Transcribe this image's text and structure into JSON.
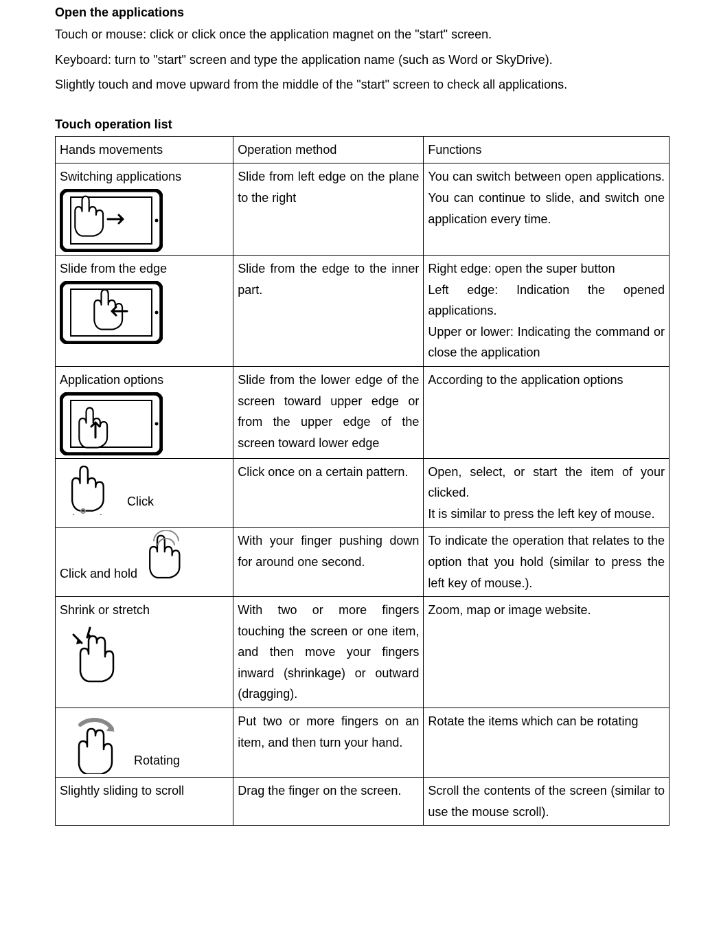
{
  "heading_open": "Open the applications",
  "open_p1": "Touch or mouse: click or click once the application magnet on the \"start\" screen.",
  "open_p2": "Keyboard: turn to \"start\" screen and type the application name (such as Word or SkyDrive).",
  "open_p3": "Slightly touch and move upward from the middle of the \"start\" screen to check all applications.",
  "heading_touch": "Touch operation list",
  "table": {
    "header": {
      "c1": "Hands movements",
      "c2": "Operation method",
      "c3": "Functions"
    },
    "rows": [
      {
        "label": "Switching applications",
        "icon": "tablet-swipe-left",
        "method": "Slide from left edge on the plane to the right",
        "func": "You can switch between open applications. You can continue to slide, and switch one application every time."
      },
      {
        "label": "Slide from the edge",
        "icon": "tablet-swipe-right-edge",
        "method": "Slide from the edge to the inner part.",
        "func": "Right edge: open the super button\nLeft edge: Indication the opened applications.\nUpper or lower: Indicating the command or close the application"
      },
      {
        "label": "Application options",
        "icon": "tablet-swipe-up",
        "method": "Slide from the lower edge of the screen toward upper edge or from the upper edge of the screen toward lower edge",
        "func": "According to the application options"
      },
      {
        "label": "Click",
        "icon": "hand-tap",
        "method": "Click once on a certain pattern.",
        "func": "Open, select, or start the item of your clicked.\nIt is similar to press the left key of mouse."
      },
      {
        "label": "Click and hold",
        "icon": "hand-tap-hold",
        "method": "With your finger pushing down for around one second.",
        "func": "To indicate the operation that relates to the option that you hold (similar to press the left key of mouse.)."
      },
      {
        "label": "Shrink or stretch",
        "icon": "hand-pinch",
        "method": "With two or more fingers touching the screen or one item, and then move your fingers inward (shrinkage) or outward (dragging).",
        "func": "Zoom, map or image website."
      },
      {
        "label": "Rotating",
        "icon": "hand-rotate",
        "method": "Put two or more fingers on an item, and then turn your hand.",
        "func": "Rotate the items which can be rotating"
      },
      {
        "label": "Slightly sliding to scroll",
        "icon": "none",
        "method": "Drag the finger on the screen.",
        "func": "Scroll the contents of the screen (similar to use the mouse scroll)."
      }
    ]
  }
}
